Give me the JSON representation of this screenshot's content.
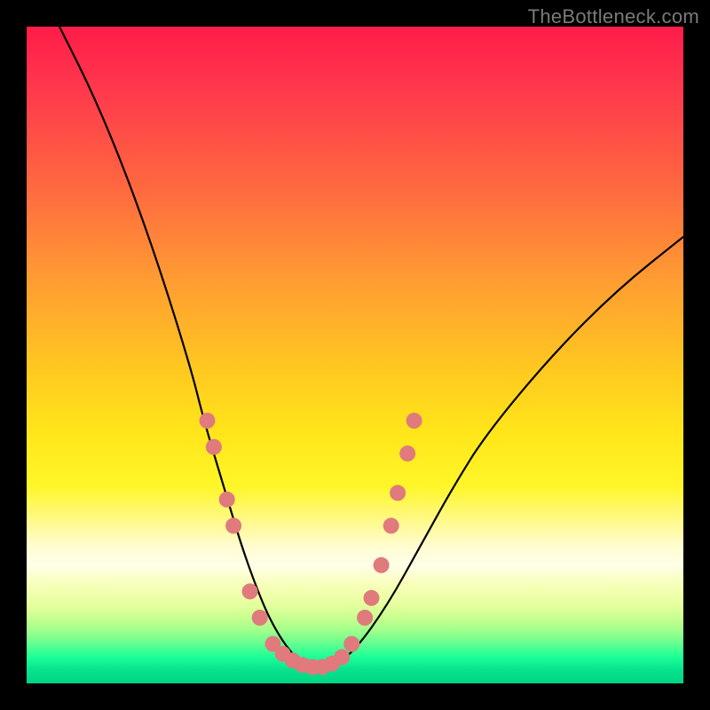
{
  "watermark": "TheBottleneck.com",
  "colors": {
    "dot": "#e07a7c",
    "curve": "#000000",
    "frame": "#000000"
  },
  "chart_data": {
    "type": "line",
    "title": "",
    "xlabel": "",
    "ylabel": "",
    "xlim": [
      0,
      100
    ],
    "ylim": [
      0,
      100
    ],
    "grid": false,
    "legend": false,
    "note": "Axis values are percent-of-plot estimates; no numeric tick labels are visible.",
    "series": [
      {
        "name": "bottleneck-curve",
        "x": [
          5,
          10,
          15,
          20,
          25,
          27,
          30,
          33,
          36,
          38,
          40,
          42,
          44,
          46,
          50,
          55,
          60,
          65,
          70,
          80,
          90,
          100
        ],
        "y": [
          100,
          90,
          78,
          64,
          48,
          40,
          30,
          20,
          12,
          8,
          5,
          3,
          2,
          2,
          5,
          12,
          21,
          30,
          38,
          50,
          60,
          68
        ]
      }
    ],
    "markers": [
      {
        "x": 27.5,
        "y": 40
      },
      {
        "x": 28.5,
        "y": 36
      },
      {
        "x": 30.5,
        "y": 28
      },
      {
        "x": 31.5,
        "y": 24
      },
      {
        "x": 34.0,
        "y": 14
      },
      {
        "x": 35.5,
        "y": 10
      },
      {
        "x": 37.5,
        "y": 6
      },
      {
        "x": 39.0,
        "y": 4.5
      },
      {
        "x": 40.5,
        "y": 3.5
      },
      {
        "x": 42.0,
        "y": 2.8
      },
      {
        "x": 43.5,
        "y": 2.5
      },
      {
        "x": 45.0,
        "y": 2.5
      },
      {
        "x": 46.5,
        "y": 3.0
      },
      {
        "x": 48.0,
        "y": 4.0
      },
      {
        "x": 49.5,
        "y": 6.0
      },
      {
        "x": 51.5,
        "y": 10
      },
      {
        "x": 52.5,
        "y": 13
      },
      {
        "x": 54.0,
        "y": 18
      },
      {
        "x": 55.5,
        "y": 24
      },
      {
        "x": 56.5,
        "y": 29
      },
      {
        "x": 58.0,
        "y": 35
      },
      {
        "x": 59.0,
        "y": 40
      }
    ]
  }
}
